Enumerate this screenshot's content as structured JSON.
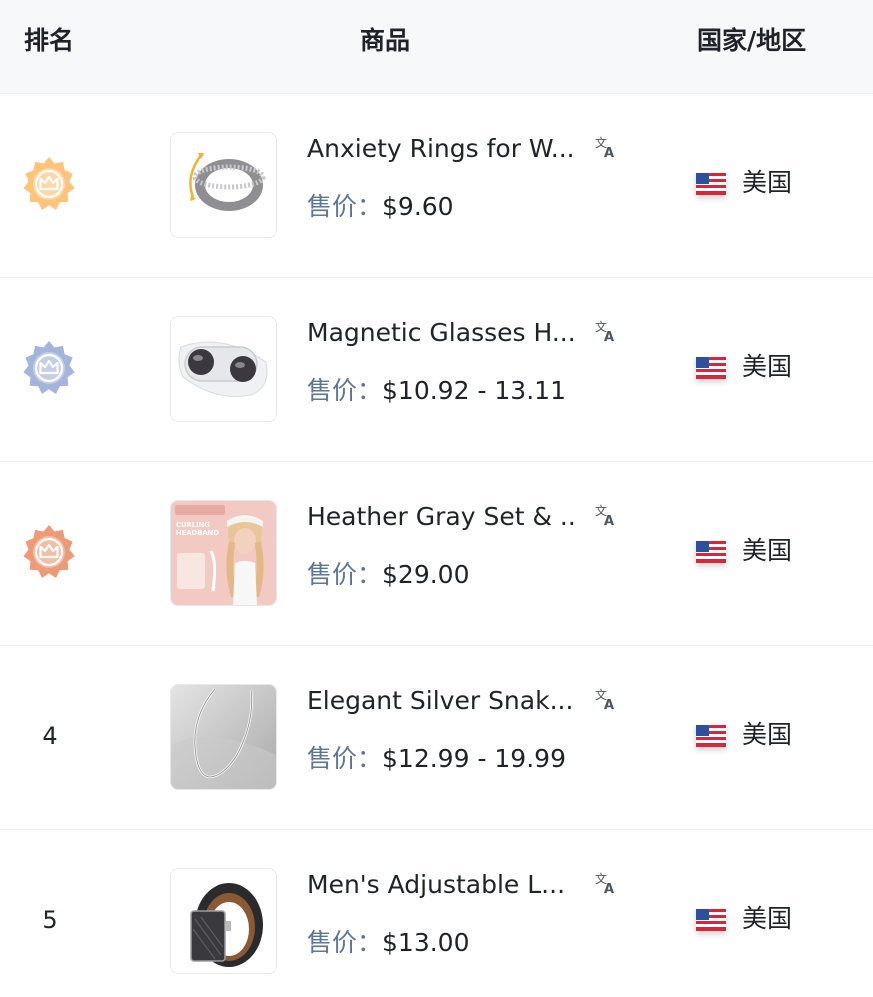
{
  "header": {
    "rank": "排名",
    "product": "商品",
    "country": "国家/地区"
  },
  "rows": [
    {
      "rank": "1",
      "badge": "gold-crown-badge-icon",
      "badge_color": "#ffc47a",
      "title": "Anxiety Rings for W...",
      "price_label": "售价：",
      "price": "$9.60",
      "country": "美国",
      "image": "spinner-ring-image"
    },
    {
      "rank": "2",
      "badge": "silver-crown-badge-icon",
      "badge_color": "#a5b4dc",
      "title": "Magnetic Glasses H...",
      "price_label": "售价：",
      "price": "$10.92 - 13.11",
      "country": "美国",
      "image": "magnetic-glasses-holder-image"
    },
    {
      "rank": "3",
      "badge": "bronze-crown-badge-icon",
      "badge_color": "#ee9a77",
      "title": "Heather Gray Set & ...",
      "price_label": "售价：",
      "price": "$29.00",
      "country": "美国",
      "image": "curling-headband-image",
      "image_text": "CURLING HEADBAND"
    },
    {
      "rank": "4",
      "title": "Elegant Silver Snak...",
      "price_label": "售价：",
      "price": "$12.99 - 19.99",
      "country": "美国",
      "image": "silver-snake-chain-image"
    },
    {
      "rank": "5",
      "title": "Men's Adjustable L...",
      "price_label": "售价：",
      "price": "$13.00",
      "country": "美国",
      "image": "leather-belt-image"
    }
  ],
  "colors": {
    "header_bg": "#f7f8fa",
    "price_label": "#5e7593",
    "text": "#1f2329",
    "divider": "#eef0f3"
  },
  "icons": {
    "translate": "translate-icon",
    "flag": "us-flag-icon"
  }
}
